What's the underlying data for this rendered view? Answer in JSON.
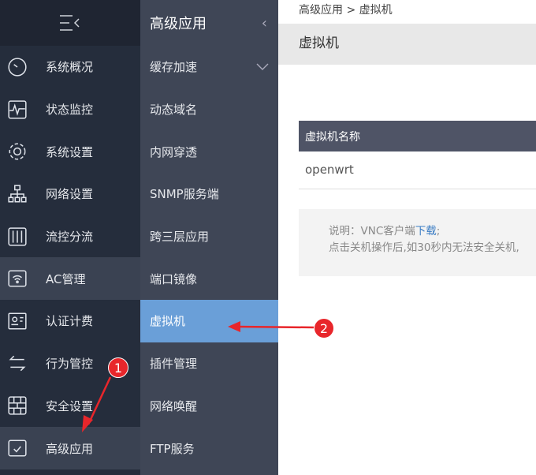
{
  "nav1": {
    "items": [
      {
        "label": "系统概况",
        "icon": "dashboard-icon"
      },
      {
        "label": "状态监控",
        "icon": "monitor-icon"
      },
      {
        "label": "系统设置",
        "icon": "gear-icon"
      },
      {
        "label": "网络设置",
        "icon": "network-icon"
      },
      {
        "label": "流控分流",
        "icon": "sliders-icon"
      },
      {
        "label": "AC管理",
        "icon": "wifi-icon"
      },
      {
        "label": "认证计费",
        "icon": "id-card-icon"
      },
      {
        "label": "行为管控",
        "icon": "arrows-icon"
      },
      {
        "label": "安全设置",
        "icon": "firewall-icon"
      },
      {
        "label": "高级应用",
        "icon": "checkbox-icon"
      }
    ]
  },
  "nav2": {
    "title": "高级应用",
    "items": [
      "缓存加速",
      "动态域名",
      "内网穿透",
      "SNMP服务端",
      "跨三层应用",
      "端口镜像",
      "虚拟机",
      "插件管理",
      "网络唤醒",
      "FTP服务"
    ]
  },
  "main": {
    "breadcrumb": "高级应用 > 虚拟机",
    "title": "虚拟机",
    "table": {
      "header": "虚拟机名称",
      "rows": [
        "openwrt"
      ]
    },
    "note": {
      "prefix": "说明：VNC客户端",
      "link": "下载",
      "suffix": ";",
      "line2": "点击关机操作后,如30秒内无法安全关机,"
    }
  },
  "annotations": [
    "1",
    "2"
  ],
  "colors": {
    "accent": "#6a9fd8",
    "badge": "#e8262b"
  }
}
